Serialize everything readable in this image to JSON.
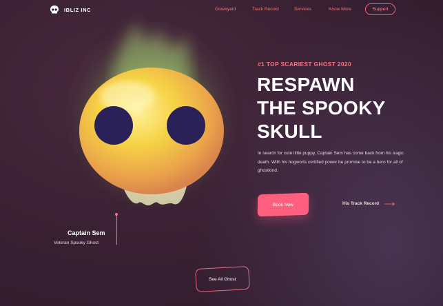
{
  "brand": {
    "name": "IBLIZ INC",
    "icon": "skull-logo-icon"
  },
  "nav": {
    "links": [
      {
        "label": "Graveyard"
      },
      {
        "label": "Track Record"
      },
      {
        "label": "Services"
      },
      {
        "label": "Know More"
      }
    ],
    "support_label": "Support"
  },
  "hero": {
    "eyebrow": "#1 TOP SCARIEST  GHOST 2020",
    "headline_lines": [
      "RESPAWN",
      "THE SPOOKY",
      "SKULL"
    ],
    "description": "In search for cute little puppy, Captain Sem has come back from his tragic death. With his hogworts certified power he promise to be a hero for all of ghostkind.",
    "book_label": "Book Now",
    "record_label": "His Track Record",
    "record_icon": "arrow-right-icon"
  },
  "character": {
    "name": "Captain Sem",
    "role": "Veteran Spooky Ghost"
  },
  "see_all_label": "See All Ghost",
  "colors": {
    "accent": "#ff5f7e",
    "link": "#f07a7a",
    "background": "#3a2133",
    "skull_glow": "#9fd67a",
    "skull_body": "#f5c93a",
    "eyes": "#2a2158"
  }
}
